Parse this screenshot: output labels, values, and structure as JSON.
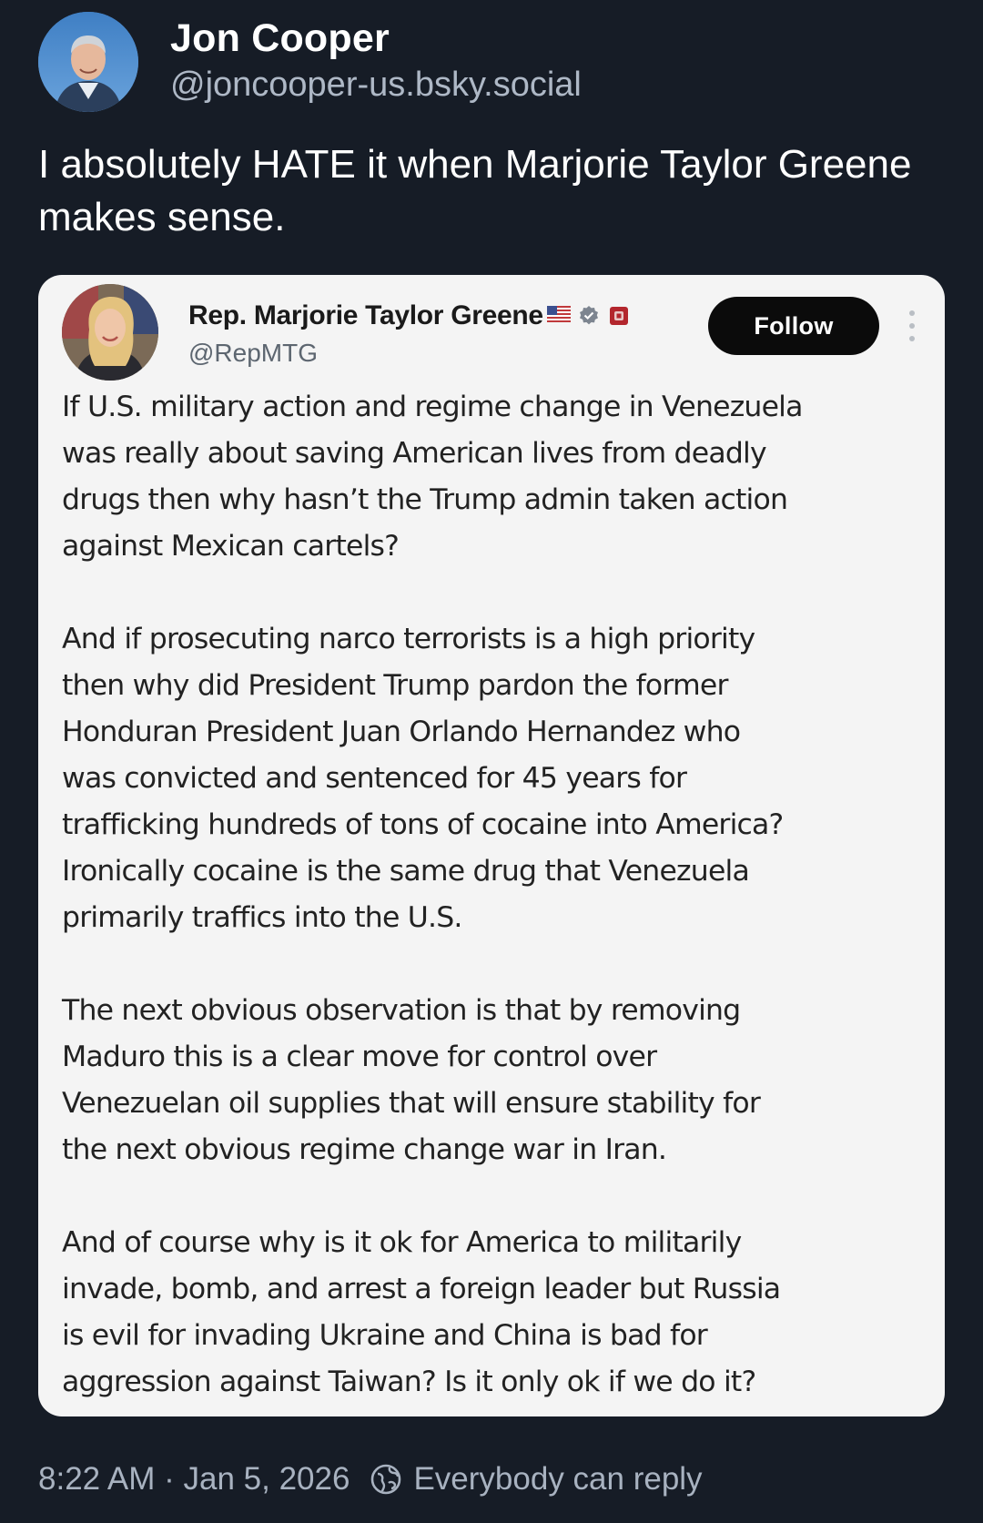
{
  "author": {
    "name": "Jon Cooper",
    "handle": "@joncooper-us.bsky.social",
    "avatar_icon": "profile-photo"
  },
  "post": {
    "text": "I absolutely HATE it when Marjorie Taylor Greene makes sense."
  },
  "embed": {
    "name": "Rep. Marjorie Taylor Greene",
    "handle": "@RepMTG",
    "follow_label": "Follow",
    "icons": [
      "us-flag-icon",
      "verified-badge-icon",
      "government-badge-icon",
      "more-options-icon"
    ],
    "paragraphs": [
      "If U.S. military action and regime change in Venezuela\nwas really about saving American lives from deadly\ndrugs then why hasn’t the Trump admin taken action\nagainst Mexican cartels?",
      "And if prosecuting narco terrorists is a high priority\nthen why did President Trump pardon the former\nHonduran President Juan Orlando Hernandez who\nwas convicted and sentenced for 45 years for\ntrafficking hundreds of tons of cocaine into America?\nIronically cocaine is the same drug that Venezuela\nprimarily traffics into the U.S.",
      "The next obvious observation is that by removing\nMaduro this is a clear move for control over\nVenezuelan oil supplies that will ensure stability for\nthe next obvious regime change war in Iran.",
      "And of course why is it ok for America to militarily\ninvade, bomb, and arrest a foreign leader but Russia\nis evil for invading Ukraine and China is bad for\naggression against Taiwan? Is it only ok if we do it?"
    ]
  },
  "footer": {
    "timestamp": "8:22 AM · Jan 5, 2026",
    "reply_setting": "Everybody can reply"
  },
  "colors": {
    "background": "#161c26",
    "card": "#f4f4f4",
    "secondary_text": "#a8b2c0"
  }
}
